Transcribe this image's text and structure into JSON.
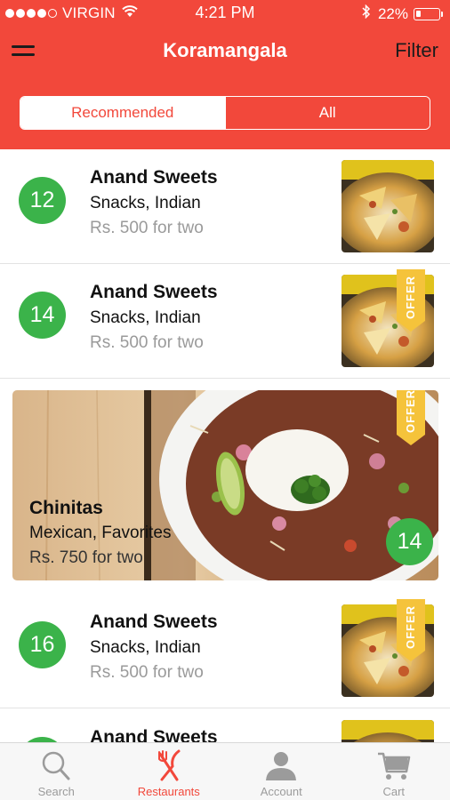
{
  "status_bar": {
    "carrier": "VIRGIN",
    "time": "4:21 PM",
    "battery_percent": "22%",
    "battery_level": 0.22
  },
  "navbar": {
    "title": "Koramangala",
    "filter_label": "Filter",
    "menu_icon": "hamburger-icon"
  },
  "segmented_control": {
    "selected": "Recommended",
    "options": [
      "Recommended",
      "All"
    ]
  },
  "restaurants": [
    {
      "score": "12",
      "name": "Anand Sweets",
      "cuisine": "Snacks, Indian",
      "cost": "Rs. 500 for two",
      "offer": false
    },
    {
      "score": "14",
      "name": "Anand Sweets",
      "cuisine": "Snacks, Indian",
      "cost": "Rs. 500 for two",
      "offer": true,
      "offer_label": "OFFER"
    },
    {
      "score": "16",
      "name": "Anand Sweets",
      "cuisine": "Snacks, Indian",
      "cost": "Rs. 500 for two",
      "offer": true,
      "offer_label": "OFFER"
    },
    {
      "name": "Anand Sweets"
    }
  ],
  "featured": {
    "name": "Chinitas",
    "cuisine": "Mexican, Favorites",
    "cost": "Rs. 750 for two",
    "score": "14",
    "offer": true,
    "offer_label": "OFFER"
  },
  "tab_bar": {
    "tabs": [
      {
        "label": "Search",
        "icon": "search-icon",
        "active": false
      },
      {
        "label": "Restaurants",
        "icon": "fork-knife-icon",
        "active": true
      },
      {
        "label": "Account",
        "icon": "user-icon",
        "active": false
      },
      {
        "label": "Cart",
        "icon": "cart-icon",
        "active": false
      }
    ]
  },
  "colors": {
    "brand_red": "#f2483b",
    "score_green": "#3bb34a",
    "offer_yellow": "#f5c33b"
  }
}
